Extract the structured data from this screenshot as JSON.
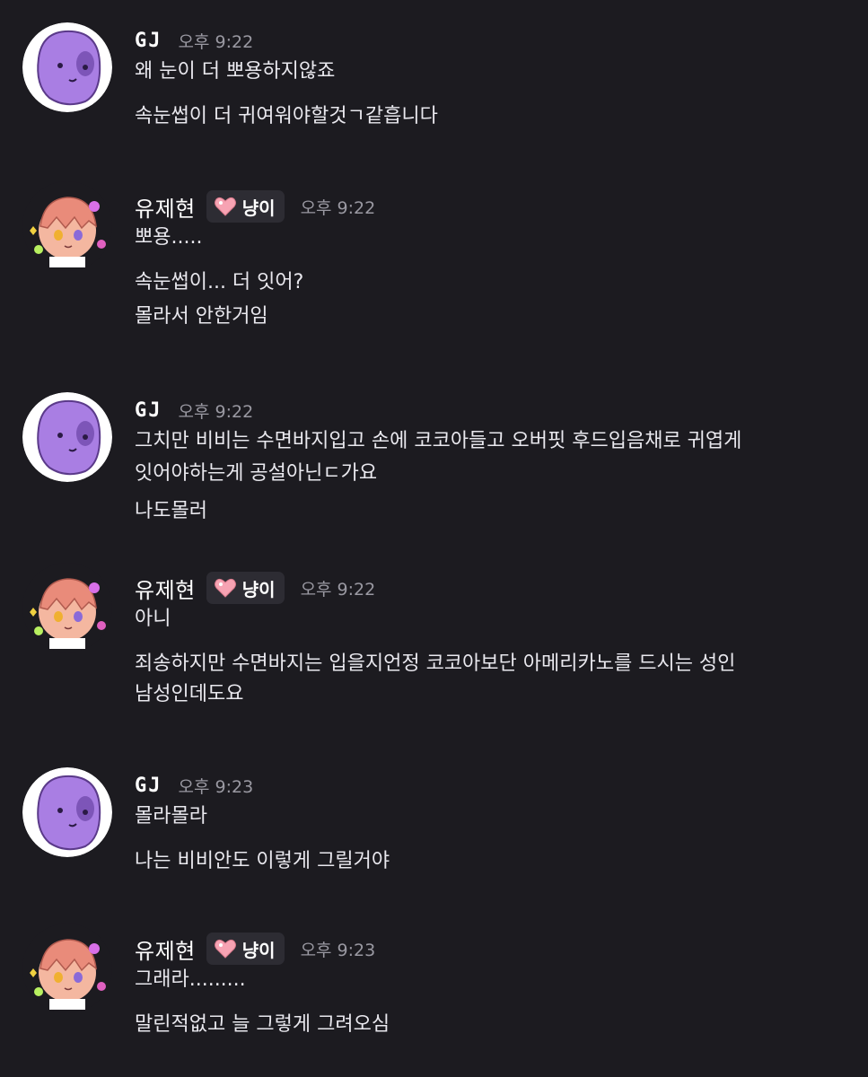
{
  "messages": [
    {
      "author": "GJ",
      "role": "",
      "time": "오후 9:22",
      "lines": [
        "왜 눈이 더 뽀용하지않죠",
        "속눈썹이 더 귀여워야할것ㄱ같흡니다"
      ]
    },
    {
      "author": "유제현",
      "role": "냥이",
      "time": "오후 9:22",
      "lines": [
        "뽀용.....",
        "속눈썹이... 더 잇어?",
        "몰라서 안한거임"
      ]
    },
    {
      "author": "GJ",
      "role": "",
      "time": "오후 9:22",
      "lines": [
        "그치만 비비는 수면바지입고 손에 코코아들고 오버핏 후드입음채로 귀엽게",
        "잇어야하는게 공설아닌ㄷ가요",
        "나도몰러"
      ]
    },
    {
      "author": "유제현",
      "role": "냥이",
      "time": "오후 9:22",
      "lines": [
        "아니",
        "죄송하지만 수면바지는 입을지언정 코코아보단 아메리카노를 드시는 성인",
        "남성인데도요"
      ]
    },
    {
      "author": "GJ",
      "role": "",
      "time": "오후 9:23",
      "lines": [
        "몰라몰라",
        "나는 비비안도 이렇게 그릴거야"
      ]
    },
    {
      "author": "유제현",
      "role": "냥이",
      "time": "오후 9:23",
      "lines": [
        "그래라.........",
        "말린적없고 늘 그렇게 그려오심"
      ]
    }
  ],
  "colors": {
    "background": "#1c1b20",
    "badge_bg": "#2d2c33",
    "timestamp": "#9a99a2",
    "text": "#e9e8ee",
    "gj_avatar_purple": "#a97ee3",
    "heart_pink": "#f7a3b3"
  },
  "icons": {
    "gj_avatar": "purple-blob-avatar",
    "yjh_avatar": "anime-boy-sticker-avatar",
    "role_icon": "pink-heart-icon"
  }
}
